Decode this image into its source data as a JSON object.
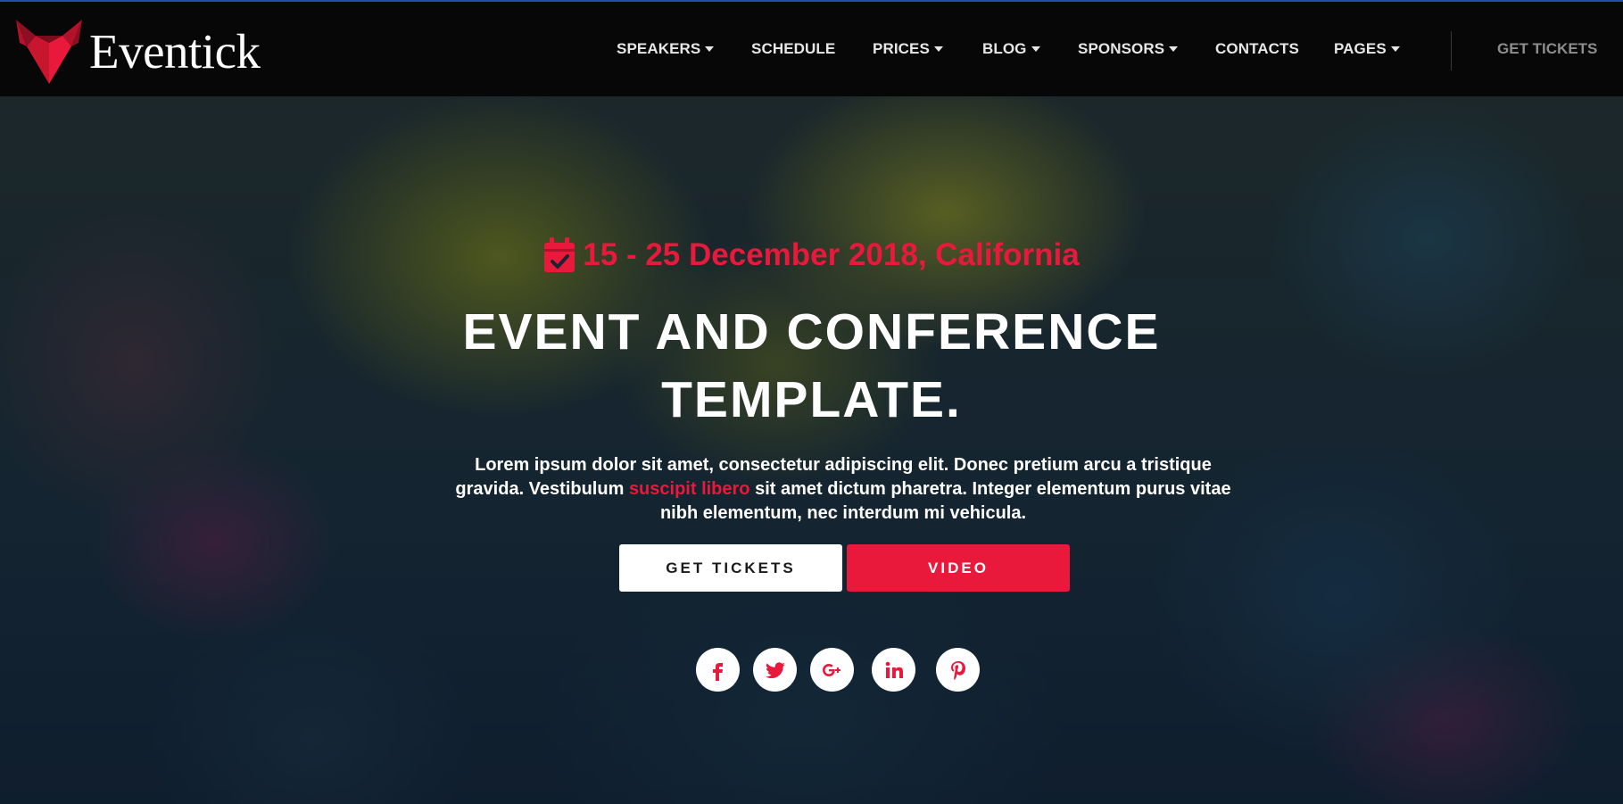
{
  "brand": {
    "name": "Eventick",
    "accent_color": "#e8193b",
    "logo_icon": "fox-head-logo-icon"
  },
  "nav": {
    "items": [
      {
        "label": "SPEAKERS",
        "has_dropdown": true
      },
      {
        "label": "SCHEDULE",
        "has_dropdown": false
      },
      {
        "label": "PRICES",
        "has_dropdown": true
      },
      {
        "label": "BLOG",
        "has_dropdown": true
      },
      {
        "label": "SPONSORS",
        "has_dropdown": true
      },
      {
        "label": "CONTACTS",
        "has_dropdown": false
      },
      {
        "label": "PAGES",
        "has_dropdown": true
      }
    ],
    "cta_label": "GET TICKETS"
  },
  "hero": {
    "date_icon": "calendar-check-icon",
    "date_text": "15 - 25 December 2018, California",
    "headline_line1": "EVENT AND CONFERENCE",
    "headline_line2": "TEMPLATE.",
    "description_part1": "Lorem ipsum dolor sit amet, consectetur adipiscing elit. Donec pretium arcu a tristique gravida. Vestibulum ",
    "description_highlight": "suscipit libero",
    "description_part2": " sit amet dictum pharetra. Integer elementum purus vitae nibh elementum, nec interdum mi vehicula.",
    "buttons": {
      "tickets_label": "GET TICKETS",
      "video_label": "VIDEO"
    },
    "social": [
      {
        "icon": "facebook-icon"
      },
      {
        "icon": "twitter-icon"
      },
      {
        "icon": "google-plus-icon"
      },
      {
        "icon": "linkedin-icon"
      },
      {
        "icon": "pinterest-icon"
      }
    ]
  }
}
